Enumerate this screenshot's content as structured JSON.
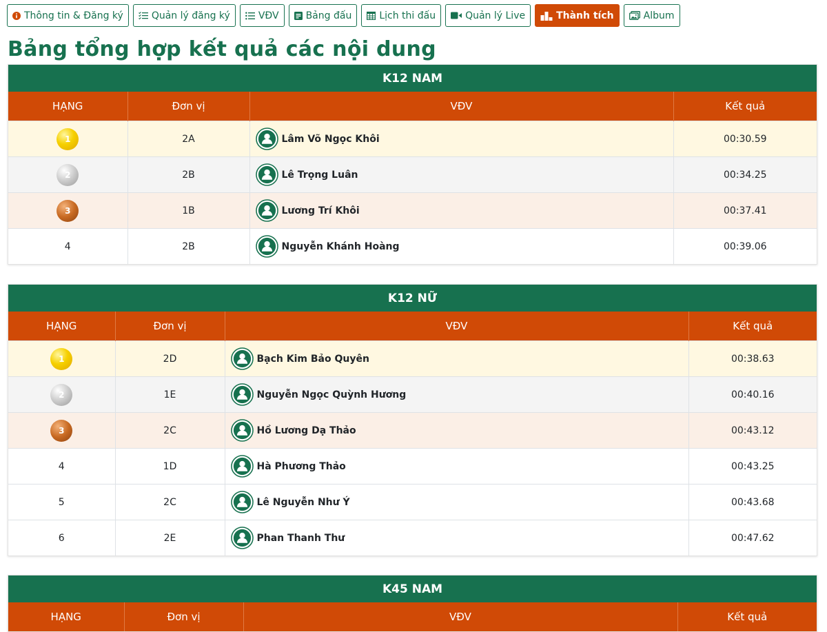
{
  "nav": {
    "items": [
      {
        "label": "Thông tin & Đăng ký",
        "icon": "info-icon"
      },
      {
        "label": "Quản lý đăng ký",
        "icon": "checklist-icon"
      },
      {
        "label": "VĐV",
        "icon": "list-icon"
      },
      {
        "label": "Bảng đấu",
        "icon": "board-icon"
      },
      {
        "label": "Lịch thi đấu",
        "icon": "calendar-icon"
      },
      {
        "label": "Quản lý Live",
        "icon": "video-camera-icon"
      },
      {
        "label": "Thành tích",
        "icon": "podium-icon",
        "active": true
      },
      {
        "label": "Album",
        "icon": "images-icon"
      }
    ]
  },
  "page_title": "Bảng tổng hợp kết quả các nội dung",
  "columns": {
    "rank": "HẠNG",
    "unit": "Đơn vị",
    "athlete": "VĐV",
    "result": "Kết quả"
  },
  "sections": [
    {
      "title": "K12 NAM",
      "rows": [
        {
          "rank": "1",
          "unit": "2A",
          "athlete": "Lâm Võ Ngọc Khôi",
          "result": "00:30.59"
        },
        {
          "rank": "2",
          "unit": "2B",
          "athlete": "Lê Trọng Luân",
          "result": "00:34.25"
        },
        {
          "rank": "3",
          "unit": "1B",
          "athlete": "Lương Trí Khôi",
          "result": "00:37.41"
        },
        {
          "rank": "4",
          "unit": "2B",
          "athlete": "Nguyễn Khánh Hoàng",
          "result": "00:39.06"
        }
      ]
    },
    {
      "title": "K12 NỮ",
      "rows": [
        {
          "rank": "1",
          "unit": "2D",
          "athlete": "Bạch Kim Bảo Quyên",
          "result": "00:38.63"
        },
        {
          "rank": "2",
          "unit": "1E",
          "athlete": "Nguyễn Ngọc Quỳnh Hương",
          "result": "00:40.16"
        },
        {
          "rank": "3",
          "unit": "2C",
          "athlete": "Hồ Lương Dạ Thảo",
          "result": "00:43.12"
        },
        {
          "rank": "4",
          "unit": "1D",
          "athlete": "Hà Phương Thảo",
          "result": "00:43.25"
        },
        {
          "rank": "5",
          "unit": "2C",
          "athlete": "Lê Nguyễn Như Ý",
          "result": "00:43.68"
        },
        {
          "rank": "6",
          "unit": "2E",
          "athlete": "Phan Thanh Thư",
          "result": "00:47.62"
        }
      ]
    },
    {
      "title": "K45 NAM",
      "rows": []
    }
  ],
  "colors": {
    "primary": "#17714f",
    "accent": "#d04a06",
    "gold": "#f6d000",
    "silver": "#c0c0c0",
    "bronze": "#c86a22"
  }
}
